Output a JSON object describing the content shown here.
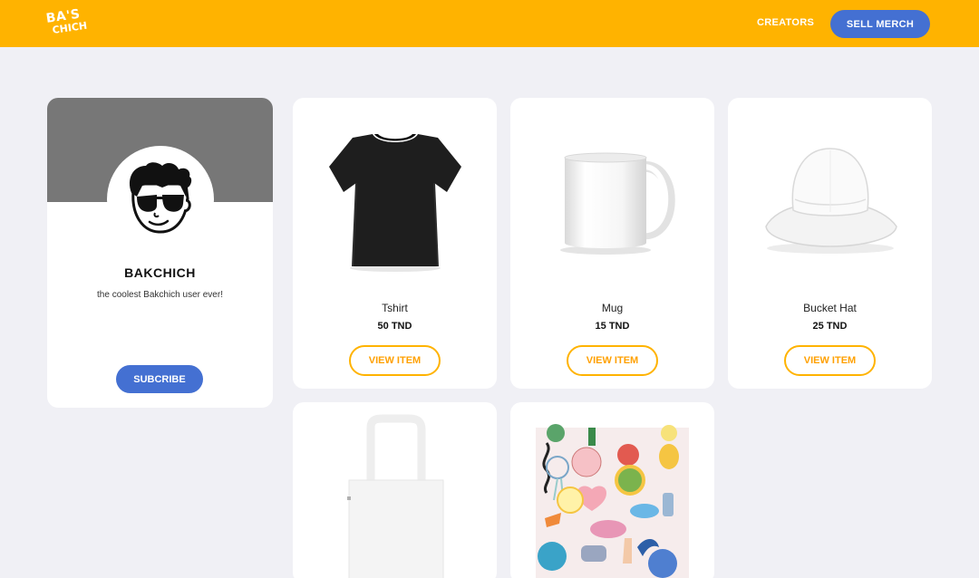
{
  "header": {
    "logo_line1": "BA'S",
    "logo_line2": "CHICH",
    "creators_label": "CREATORS",
    "sell_label": "SELL MERCH",
    "bg_color": "#ffb300",
    "accent_color": "#4470d2"
  },
  "profile": {
    "username": "BAKCHICH",
    "bio": "the coolest Bakchich user ever!",
    "subscribe_label": "SUBCRIBE"
  },
  "products": [
    {
      "name": "Tshirt",
      "price": "50 TND",
      "button": "VIEW ITEM",
      "icon": "tshirt-image"
    },
    {
      "name": "Mug",
      "price": "15 TND",
      "button": "VIEW ITEM",
      "icon": "mug-image"
    },
    {
      "name": "Bucket Hat",
      "price": "25 TND",
      "button": "VIEW ITEM",
      "icon": "bucket-hat-image"
    },
    {
      "name": "",
      "price": "",
      "button": "",
      "icon": "tote-bag-image"
    },
    {
      "name": "",
      "price": "",
      "button": "",
      "icon": "sticker-sheet-image"
    }
  ]
}
